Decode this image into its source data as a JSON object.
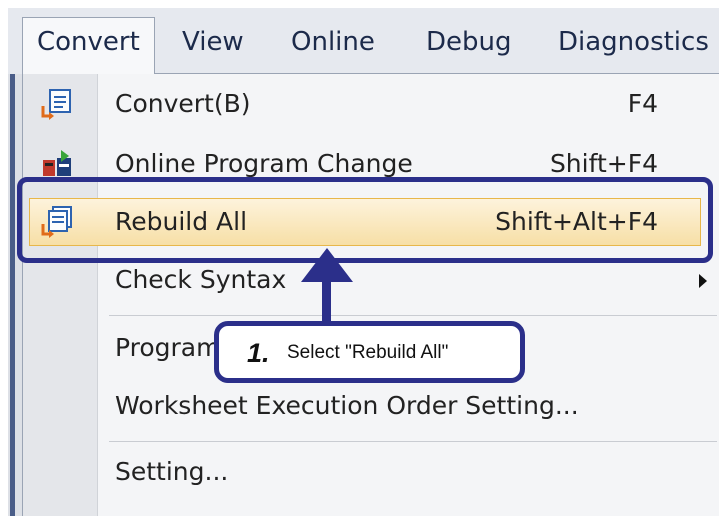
{
  "menubar": {
    "items": [
      "Convert",
      "View",
      "Online",
      "Debug",
      "Diagnostics"
    ],
    "active_index": 0
  },
  "menu": {
    "items": [
      {
        "label": "Convert(B)",
        "shortcut": "F4",
        "icon": "convert-icon"
      },
      {
        "label": "Online Program Change",
        "shortcut": "Shift+F4",
        "icon": "online-program-change-icon"
      },
      {
        "label": "Rebuild All",
        "shortcut": "Shift+Alt+F4",
        "icon": "rebuild-all-icon",
        "highlighted": true
      },
      {
        "label": "Check Syntax",
        "shortcut": "",
        "submenu": true
      },
      {
        "label": "Program",
        "shortcut": ""
      },
      {
        "label": "Worksheet Execution Order Setting...",
        "shortcut": ""
      },
      {
        "label": "Setting...",
        "shortcut": ""
      }
    ]
  },
  "callout": {
    "step": "1.",
    "text": "Select \"Rebuild All\""
  },
  "colors": {
    "annotation": "#2b2f8a",
    "highlight_fill": "#f7dfa6",
    "highlight_border": "#e8b74a",
    "menu_text": "#222222"
  }
}
